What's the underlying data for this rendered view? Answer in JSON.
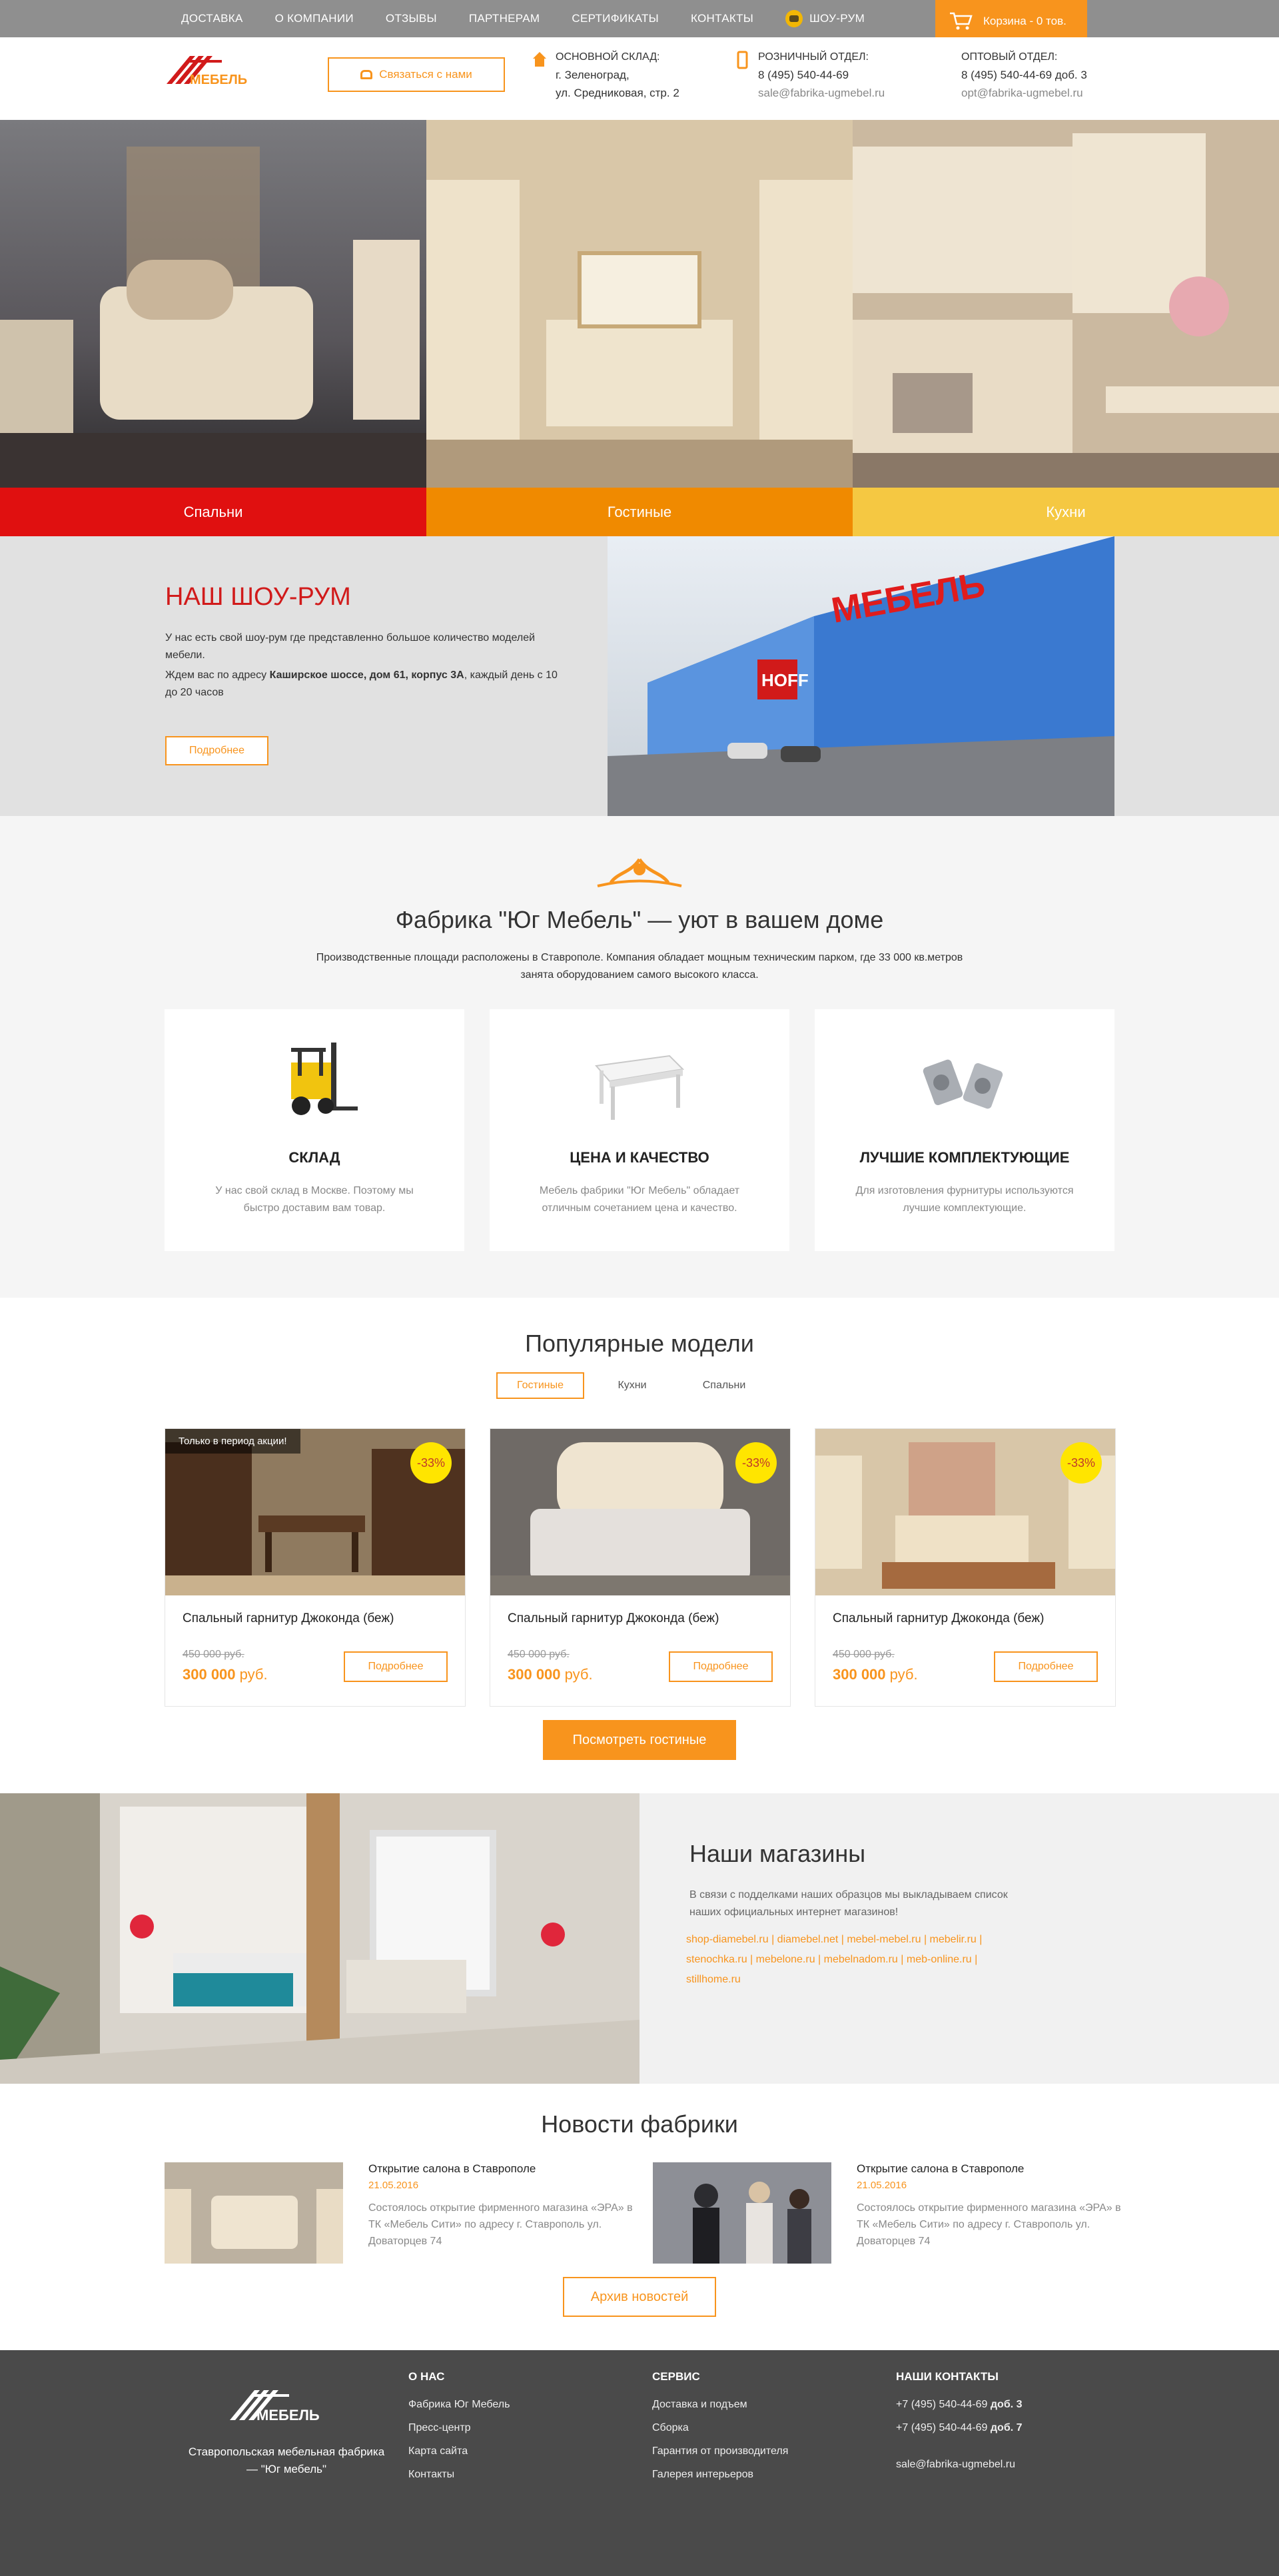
{
  "topnav": {
    "items": [
      "Доставка",
      "О компании",
      "Отзывы",
      "Партнерам",
      "Сертификаты",
      "Контакты"
    ],
    "showroom": "Шоу-рум",
    "cart": "Корзина - 0 тов."
  },
  "header": {
    "logo_text": "МЕБЕЛЬ",
    "call_button": "Связаться с нами",
    "warehouse": {
      "title": "Основной склад:",
      "line1": "г. Зеленоград,",
      "line2": "ул. Средниковая, стр. 2"
    },
    "retail": {
      "title": "Розничный отдел:",
      "phone": "8 (495) 540-44-69",
      "email": "sale@fabrika-ugmebel.ru"
    },
    "wholesale": {
      "title": "Оптовый отдел:",
      "phone": "8 (495) 540-44-69 доб. 3",
      "email": "opt@fabrika-ugmebel.ru"
    }
  },
  "banners": [
    {
      "label": "Спальни",
      "color": "#e01010"
    },
    {
      "label": "Гостиные",
      "color": "#f08a00"
    },
    {
      "label": "Кухни",
      "color": "#f5c842"
    }
  ],
  "showroom": {
    "title": "Наш шоу-рум",
    "p1": "У нас есть свой шоу-рум где представленно большое количество моделей мебели.",
    "p2_before": "Ждем вас по адресу ",
    "p2_bold": "Каширское шоссе, дом 61, корпус 3А",
    "p2_after": ", каждый день с 10 до 20 часов",
    "button": "Подробнее",
    "sign": "МЕБЕЛЬ",
    "sign2": "HOFF"
  },
  "factory": {
    "title": "Фабрика \"Юг Мебель\" — уют в вашем доме",
    "lead": "Производственные площади расположены в Ставрополе. Компания обладает мощным техническим парком, где 33 000 кв.метров занята оборудованием самого высокого класса.",
    "cards": [
      {
        "title": "Склад",
        "text": "У нас свой склад в Москве. Поэтому мы быстро доставим вам товар."
      },
      {
        "title": "Цена и качество",
        "text": "Мебель фабрики \"Юг Мебель\" обладает отличным сочетанием цена и качество."
      },
      {
        "title": "Лучшие комплектующие",
        "text": "Для изготовления фурнитуры используются лучшие комплектующие."
      }
    ]
  },
  "popular": {
    "title": "Популярные модели",
    "tabs": [
      "Гостиные",
      "Кухни",
      "Спальни"
    ],
    "products": [
      {
        "promo": "Только в период акции!",
        "badge": "-33%",
        "name": "Спальный гарнитур Джоконда (беж)",
        "old": "450 000 руб.",
        "price": "300 000",
        "currency": " руб.",
        "button": "Подробнее"
      },
      {
        "promo": "",
        "badge": "-33%",
        "name": "Спальный гарнитур Джоконда (беж)",
        "old": "450 000 руб.",
        "price": "300 000",
        "currency": " руб.",
        "button": "Подробнее"
      },
      {
        "promo": "",
        "badge": "-33%",
        "name": "Спальный гарнитур Джоконда (беж)",
        "old": "450 000 руб.",
        "price": "300 000",
        "currency": " руб.",
        "button": "Подробнее"
      }
    ],
    "see_all": "Посмотреть гостиные"
  },
  "shops": {
    "title": "Наши магазины",
    "text": "В связи с подделками наших образцов мы выкладываем список наших официальных интернет магазинов!",
    "links": "shop-diamebel.ru | diamebel.net | mebel-mebel.ru | mebelir.ru | stenochka.ru | mebelone.ru | mebelnadom.ru | meb-online.ru | stillhome.ru"
  },
  "news": {
    "title": "Новости фабрики",
    "items": [
      {
        "title": "Открытие салона в Ставрополе",
        "date": "21.05.2016",
        "text": "Состоялось открытие фирменного магазина «ЭРА» в ТК «Мебель Сити» по адресу г. Ставрополь ул. Доваторцев 74"
      },
      {
        "title": "Открытие салона в Ставрополе",
        "date": "21.05.2016",
        "text": "Состоялось открытие фирменного магазина «ЭРА» в ТК «Мебель Сити» по адресу г. Ставрополь ул. Доваторцев 74"
      }
    ],
    "archive": "Архив новостей"
  },
  "footer": {
    "logo_text": "МЕБЕЛЬ",
    "tagline": "Ставропольская мебельная фабрика — \"Юг мебель\"",
    "about": {
      "title": "О нас",
      "items": [
        "Фабрика Юг Мебель",
        "Пресс-центр",
        "Карта сайта",
        "Контакты"
      ]
    },
    "service": {
      "title": "Сервис",
      "items": [
        "Доставка и подъем",
        "Сборка",
        "Гарантия от производителя",
        "Галерея интерьеров"
      ]
    },
    "contacts": {
      "title": "Наши контакты",
      "phone1": "+7 (495) 540-44-69",
      "ext1": " доб. 3",
      "phone2": "+7 (495) 540-44-69",
      "ext2": " доб. 7",
      "email": "sale@fabrika-ugmebel.ru"
    }
  },
  "colors": {
    "accent": "#f8941d",
    "nav": "#8f8f8f",
    "footer": "#4a4a4a",
    "red": "#d11a1a"
  }
}
